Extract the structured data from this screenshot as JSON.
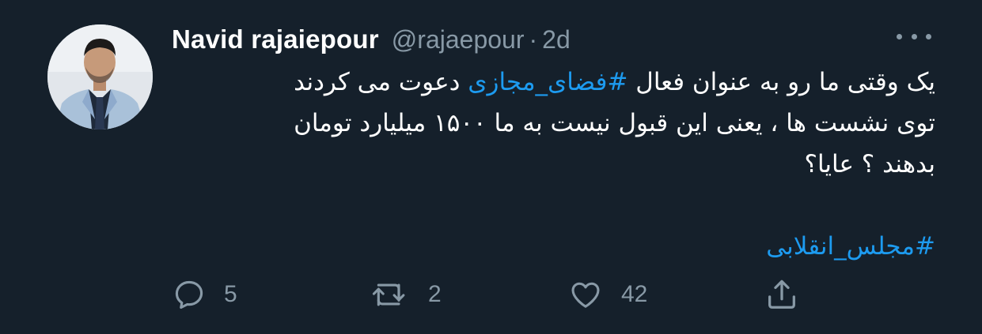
{
  "tweet": {
    "display_name": "Navid rajaiepour",
    "handle": "@rajaepour",
    "separator": "·",
    "time": "2d",
    "lines": {
      "line1_a": "یک وقتی ما رو به عنوان فعال ",
      "line1_hashtag": "#فضای_مجازی",
      "line1_b": " دعوت می کردند",
      "line2": "توی نشست ها ، یعنی این قبول نیست به ما ۱۵۰۰ میلیارد تومان",
      "line3": "بدهند ؟ عایا؟"
    },
    "hashtag2": "#مجلس_انقلابی"
  },
  "actions": {
    "reply_count": "5",
    "retweet_count": "2",
    "like_count": "42"
  },
  "colors": {
    "background": "#15202b",
    "text": "#ffffff",
    "secondary": "#8899a6",
    "link": "#1d9bf0"
  },
  "icons": [
    "avatar",
    "more-icon",
    "reply-icon",
    "retweet-icon",
    "like-icon",
    "share-icon"
  ]
}
